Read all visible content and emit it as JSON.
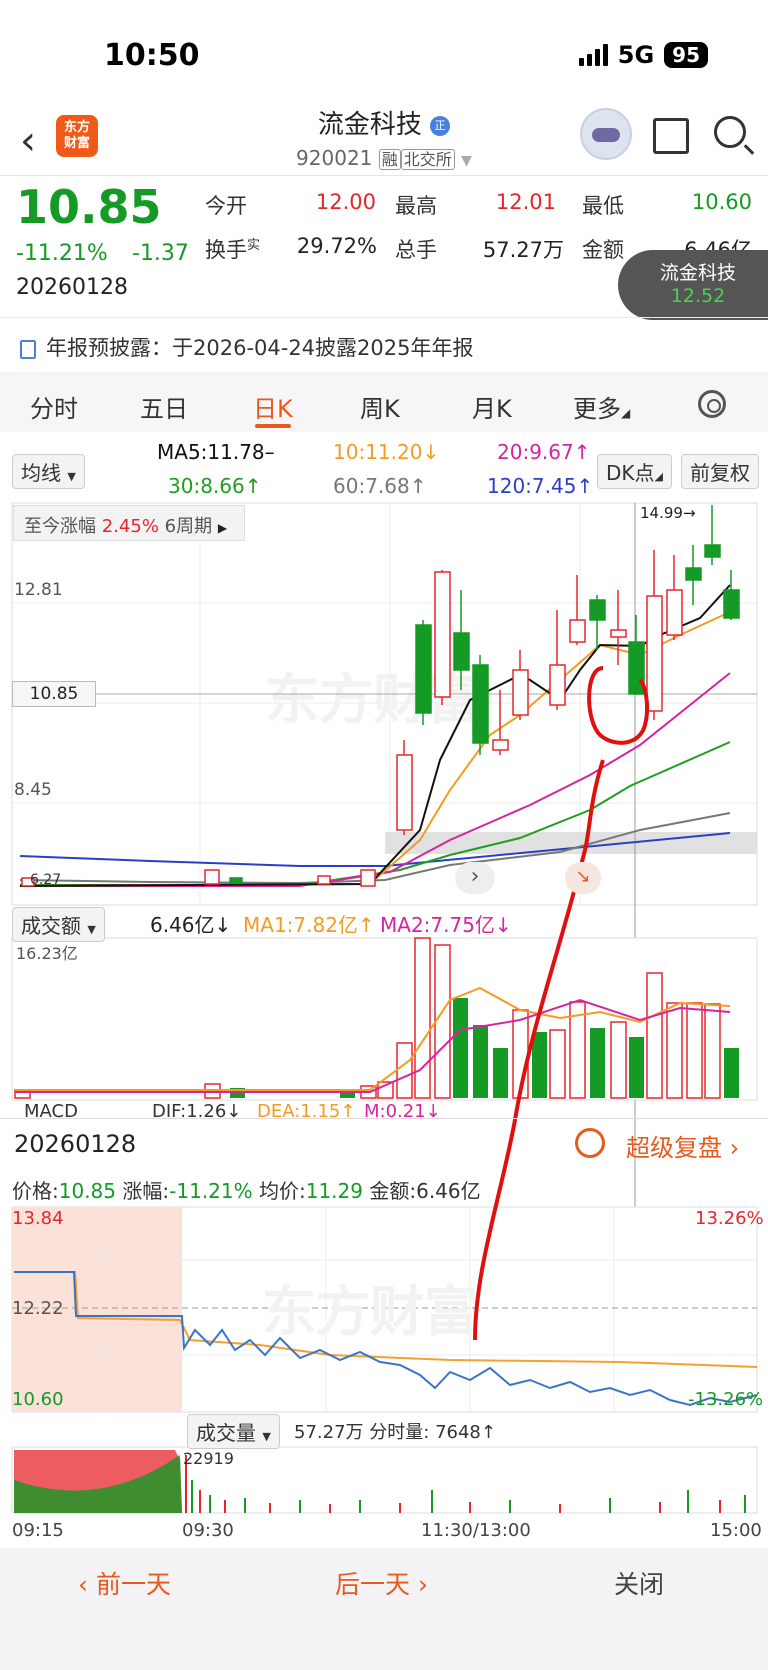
{
  "status": {
    "time": "10:50",
    "network": "5G",
    "battery": "95"
  },
  "header": {
    "logo_text": "东方财富",
    "name": "流金科技",
    "name_badge": "正",
    "code": "920021",
    "tag_margin": "融",
    "tag_exchange": "北交所"
  },
  "quote": {
    "price": "10.85",
    "change_pct": "-11.21%",
    "change": "-1.37",
    "date": "20260128",
    "open_label": "今开",
    "open": "12.00",
    "high_label": "最高",
    "high": "12.01",
    "low_label": "最低",
    "low": "10.60",
    "turnover_label": "换手",
    "turnover_sup": "实",
    "turnover": "29.72%",
    "volume_label": "总手",
    "volume": "57.27万",
    "amount_label": "金额",
    "amount": "6.46亿"
  },
  "floating_badge": {
    "name": "流金科技",
    "value": "12.52"
  },
  "notice": "年报预披露：于2026-04-24披露2025年年报",
  "tabs": [
    "分时",
    "五日",
    "日K",
    "周K",
    "月K",
    "更多"
  ],
  "active_tab": "日K",
  "ma_bar": {
    "selector": "均线",
    "ma5": "MA5:11.78–",
    "ma10": "10:11.20↓",
    "ma20": "20:9.67↑",
    "ma30": "30:8.66↑",
    "ma60": "60:7.68↑",
    "ma120": "120:7.45↑",
    "dk_button": "DK点",
    "adjust_button": "前复权"
  },
  "kline": {
    "range_label": "至今涨幅",
    "range_value": "2.45%",
    "range_period": "6周期",
    "high_mark": "14.99→",
    "y_labels": [
      "12.81",
      "10.85",
      "8.45"
    ],
    "low_mark": "6.27",
    "watermark": "东方财富"
  },
  "amount_bar": {
    "selector": "成交额",
    "value": "6.46亿↓",
    "ma1": "MA1:7.82亿↑",
    "ma2": "MA2:7.75亿↓",
    "max_label": "16.23亿"
  },
  "macd_bar": {
    "selector": "MACD",
    "dif": "DIF:1.26↓",
    "dea": "DEA:1.15↑",
    "m": "M:0.21↓"
  },
  "intraday": {
    "date": "20260128",
    "replay_label": "超级复盘",
    "price_label": "价格:",
    "price": "10.85",
    "pct_label": "涨幅:",
    "pct": "-11.21%",
    "avg_label": "均价:",
    "avg": "11.29",
    "amount_label": "金额:",
    "amount": "6.46亿",
    "y_top": "13.84",
    "y_mid": "12.22",
    "y_bot": "10.60",
    "pct_top": "13.26%",
    "pct_bot": "-13.26%",
    "volume_selector": "成交量",
    "volume_total": "57.27万",
    "minute_vol_label": "分时量:",
    "minute_vol": "7648↑",
    "vol_peak": "22919",
    "time_labels": [
      "09:15",
      "09:30",
      "11:30/13:00",
      "15:00"
    ]
  },
  "bottom": {
    "prev": "前一天",
    "next": "后一天",
    "close": "关闭"
  },
  "colors": {
    "up": "#e5262b",
    "down": "#159a25",
    "accent": "#e85a1c",
    "ma5": "#111111",
    "ma10": "#f59a23",
    "ma20": "#d6249f",
    "ma30": "#1f9e1f",
    "ma60": "#777777",
    "ma120": "#2a3fc8"
  }
}
